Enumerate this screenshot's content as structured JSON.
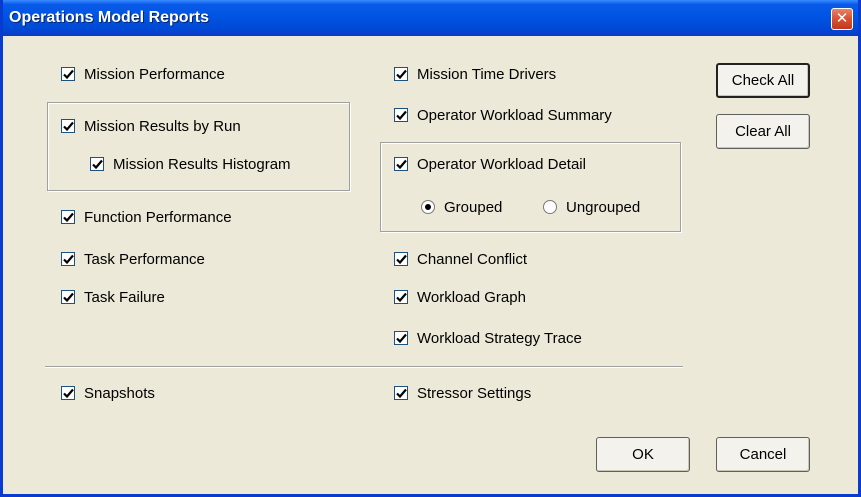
{
  "window": {
    "title": "Operations Model Reports",
    "close_glyph": "✕"
  },
  "left": {
    "mission_performance": "Mission Performance",
    "mission_results_by_run": "Mission Results by Run",
    "mission_results_histogram": "Mission Results Histogram",
    "function_performance": "Function Performance",
    "task_performance": "Task Performance",
    "task_failure": "Task Failure",
    "snapshots": "Snapshots"
  },
  "middle": {
    "mission_time_drivers": "Mission Time Drivers",
    "operator_workload_summary": "Operator Workload Summary",
    "operator_workload_detail": "Operator Workload Detail",
    "grouped": "Grouped",
    "ungrouped": "Ungrouped",
    "channel_conflict": "Channel Conflict",
    "workload_graph": "Workload Graph",
    "workload_strategy_trace": "Workload Strategy Trace",
    "stressor_settings": "Stressor Settings"
  },
  "buttons": {
    "check_all": "Check All",
    "clear_all": "Clear All",
    "ok": "OK",
    "cancel": "Cancel"
  },
  "state": {
    "all_checked": true,
    "detail_mode": "Grouped"
  }
}
